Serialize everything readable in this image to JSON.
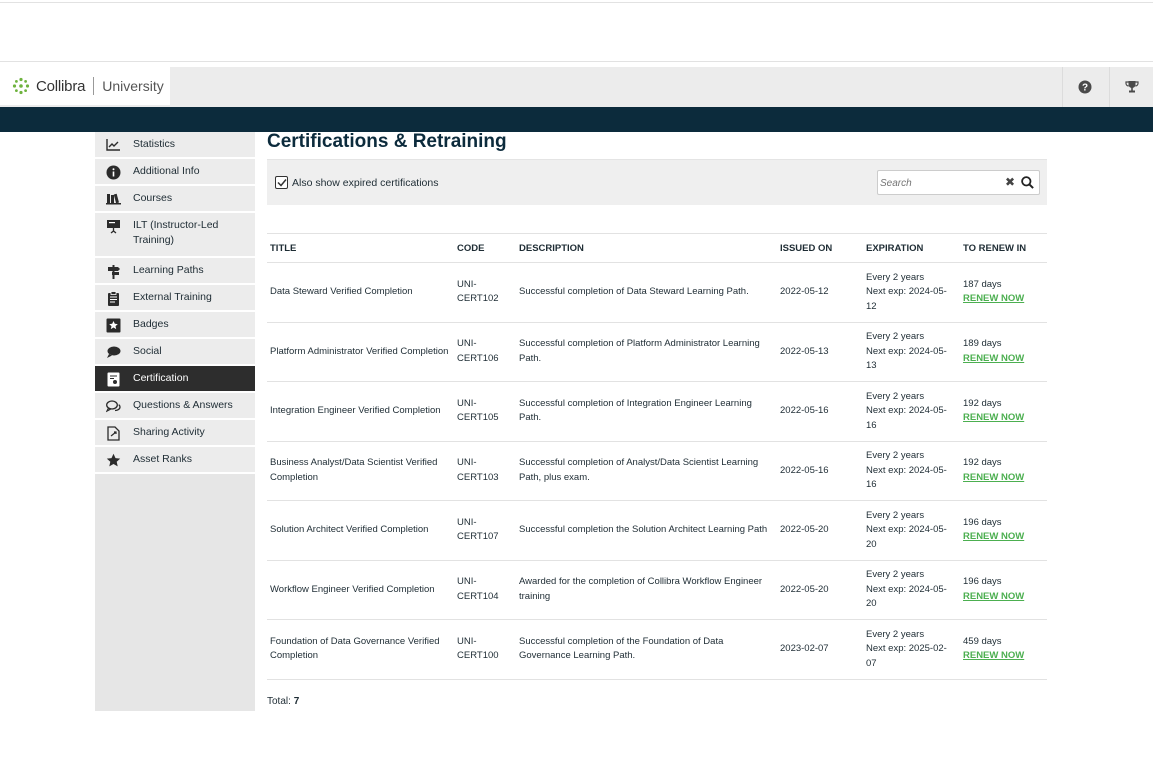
{
  "header": {
    "brand": "Collibra",
    "sub_brand": "University",
    "help_icon": "help-circle-icon",
    "trophy_icon": "trophy-icon"
  },
  "sidebar": {
    "items": [
      {
        "label": "Statistics",
        "icon": "line-chart-icon"
      },
      {
        "label": "Additional Info",
        "icon": "info-icon"
      },
      {
        "label": "Courses",
        "icon": "books-icon"
      },
      {
        "label": "ILT (Instructor-Led Training)",
        "icon": "presentation-icon"
      },
      {
        "label": "Learning Paths",
        "icon": "signpost-icon"
      },
      {
        "label": "External Training",
        "icon": "clipboard-icon"
      },
      {
        "label": "Badges",
        "icon": "star-badge-icon"
      },
      {
        "label": "Social",
        "icon": "chat-bubbles-icon"
      },
      {
        "label": "Certification",
        "icon": "certificate-icon",
        "active": true
      },
      {
        "label": "Questions & Answers",
        "icon": "comments-icon"
      },
      {
        "label": "Sharing Activity",
        "icon": "share-document-icon"
      },
      {
        "label": "Asset Ranks",
        "icon": "star-icon"
      }
    ]
  },
  "main": {
    "title": "Certifications & Retraining",
    "show_expired_label": "Also show expired certifications",
    "show_expired_checked": true,
    "search_placeholder": "Search",
    "clear_glyph": "✖",
    "columns": [
      "TITLE",
      "CODE",
      "DESCRIPTION",
      "ISSUED ON",
      "EXPIRATION",
      "TO RENEW IN"
    ],
    "rows": [
      {
        "title": "Data Steward Verified Completion",
        "code": "UNI-CERT102",
        "description": "Successful completion of Data Steward Learning Path.",
        "issued": "2022-05-12",
        "exp_every": "Every 2 years",
        "exp_next": "Next exp: 2024-05-12",
        "renew_days": "187 days",
        "renew_label": "RENEW NOW"
      },
      {
        "title": "Platform Administrator Verified Completion",
        "code": "UNI-CERT106",
        "description": "Successful completion of Platform Administrator Learning Path.",
        "issued": "2022-05-13",
        "exp_every": "Every 2 years",
        "exp_next": "Next exp: 2024-05-13",
        "renew_days": "189 days",
        "renew_label": "RENEW NOW"
      },
      {
        "title": "Integration Engineer Verified Completion",
        "code": "UNI-CERT105",
        "description": "Successful completion of Integration Engineer Learning Path.",
        "issued": "2022-05-16",
        "exp_every": "Every 2 years",
        "exp_next": "Next exp: 2024-05-16",
        "renew_days": "192 days",
        "renew_label": "RENEW NOW"
      },
      {
        "title": "Business Analyst/Data Scientist Verified Completion",
        "code": "UNI-CERT103",
        "description": "Successful completion of Analyst/Data Scientist Learning Path, plus exam.",
        "issued": "2022-05-16",
        "exp_every": "Every 2 years",
        "exp_next": "Next exp: 2024-05-16",
        "renew_days": "192 days",
        "renew_label": "RENEW NOW"
      },
      {
        "title": "Solution Architect Verified Completion",
        "code": "UNI-CERT107",
        "description": "Successful completion the Solution Architect Learning Path",
        "issued": "2022-05-20",
        "exp_every": "Every 2 years",
        "exp_next": "Next exp: 2024-05-20",
        "renew_days": "196 days",
        "renew_label": "RENEW NOW"
      },
      {
        "title": "Workflow Engineer Verified Completion",
        "code": "UNI-CERT104",
        "description": "Awarded for the completion of Collibra Workflow Engineer training",
        "issued": "2022-05-20",
        "exp_every": "Every 2 years",
        "exp_next": "Next exp: 2024-05-20",
        "renew_days": "196 days",
        "renew_label": "RENEW NOW"
      },
      {
        "title": "Foundation of Data Governance Verified Completion",
        "code": "UNI-CERT100",
        "description": "Successful completion of the Foundation of Data Governance Learning Path.",
        "issued": "2023-02-07",
        "exp_every": "Every 2 years",
        "exp_next": "Next exp: 2025-02-07",
        "renew_days": "459 days",
        "renew_label": "RENEW NOW"
      }
    ],
    "total_label": "Total:",
    "total_value": "7"
  },
  "colors": {
    "nav_band": "#0c2b3c",
    "renew_link": "#4caf50",
    "active_item": "#2d2d2d"
  }
}
